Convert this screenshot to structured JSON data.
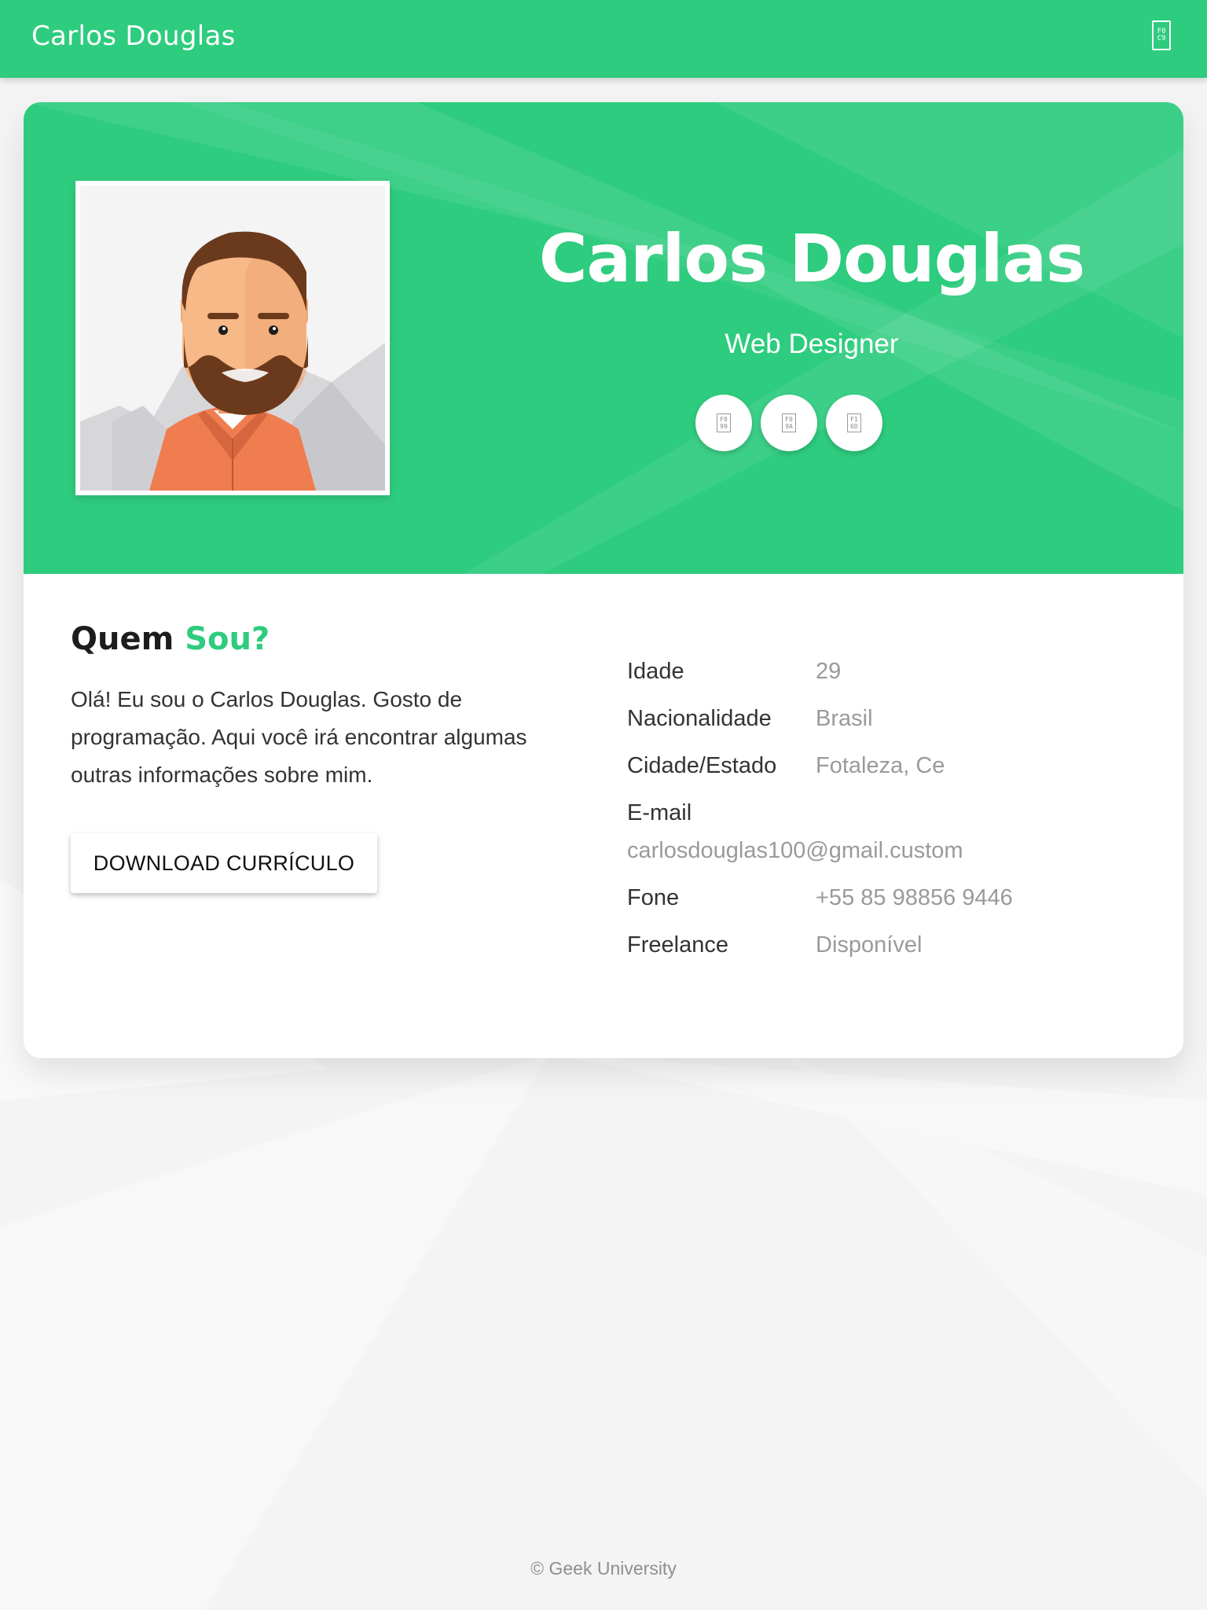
{
  "header": {
    "brand": "Carlos Douglas",
    "menu_icon_glyph": [
      "F0",
      "C9"
    ]
  },
  "profile": {
    "name": "Carlos Douglas",
    "role": "Web Designer",
    "avatar_icon": "bearded-man-avatar",
    "social": [
      {
        "icon": "social-icon-1",
        "glyph": [
          "F0",
          "99"
        ]
      },
      {
        "icon": "social-icon-2",
        "glyph": [
          "F0",
          "9A"
        ]
      },
      {
        "icon": "social-icon-3",
        "glyph": [
          "F1",
          "6D"
        ]
      }
    ]
  },
  "about": {
    "title_main": "Quem",
    "title_accent": "Sou?",
    "text": "Olá! Eu sou o Carlos Douglas. Gosto de programação. Aqui você irá encontrar algumas outras informações sobre mim.",
    "download_label": "DOWNLOAD CURRÍCULO"
  },
  "info": {
    "age_label": "Idade",
    "age_value": "29",
    "nationality_label": "Nacionalidade",
    "nationality_value": "Brasil",
    "city_label": "Cidade/Estado",
    "city_value": "Fotaleza, Ce",
    "email_label": "E-mail",
    "email_value": "carlosdouglas100@gmail.custom",
    "phone_label": "Fone",
    "phone_value": "+55 85 98856 9446",
    "freelance_label": "Freelance",
    "freelance_value": "Disponível"
  },
  "footer": {
    "text": "© Geek University"
  },
  "colors": {
    "primary": "#2ecc7e",
    "background": "#f4f4f4",
    "text_dark": "#333333",
    "text_muted": "#9a9a9a"
  }
}
